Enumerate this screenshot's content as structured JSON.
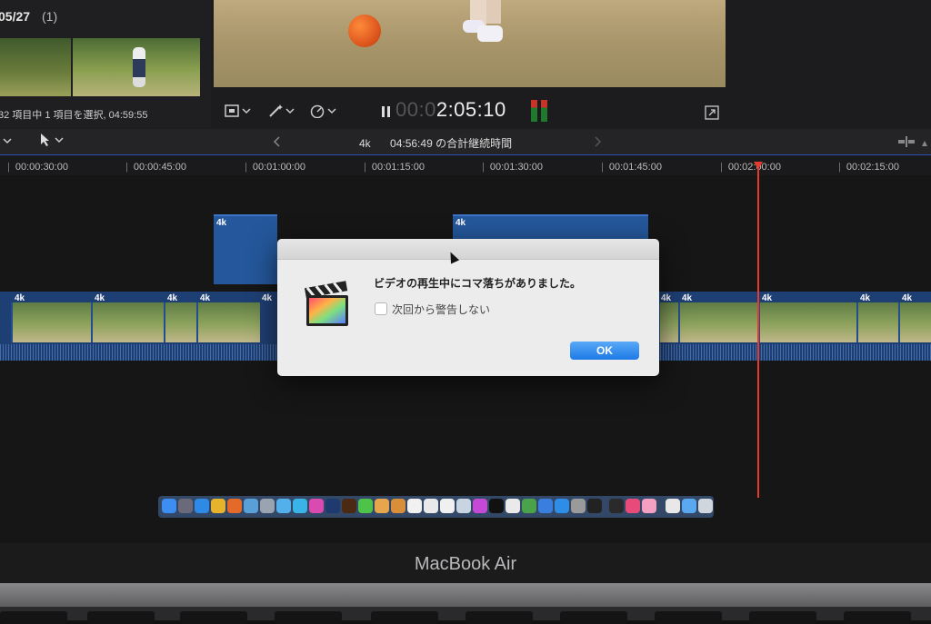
{
  "browser": {
    "date": "05/27",
    "count": "(1)",
    "status": "32 項目中 1 項目を選択, 04:59:55"
  },
  "viewer": {
    "timecode_dim": "00:0",
    "timecode_lit": "2:05:10"
  },
  "timeline": {
    "clip_format": "4k",
    "total_duration": "04:56:49 の合計継続時間",
    "ruler": [
      "00:00:30:00",
      "00:00:45:00",
      "00:01:00:00",
      "00:01:15:00",
      "00:01:30:00",
      "00:01:45:00",
      "00:02:00:00",
      "00:02:15:00"
    ],
    "clip_labels": [
      "4k",
      "4k",
      "4k",
      "4k",
      "4k",
      "4k",
      "4k",
      "4k",
      "4k",
      "4k",
      "4k",
      "4k"
    ]
  },
  "dialog": {
    "message": "ビデオの再生中にコマ落ちがありました。",
    "checkbox_label": "次回から警告しない",
    "ok_label": "OK"
  },
  "laptop": {
    "brand": "MacBook Air"
  },
  "colors": {
    "accent_blue": "#1c7ae6",
    "playhead_red": "#e33b2e",
    "clip_blue": "#24579b"
  },
  "icons": [
    "transform-icon",
    "magic-wand-icon",
    "speed-icon",
    "pause-icon",
    "fullscreen-icon",
    "select-arrow-icon",
    "chevron-left-icon",
    "chevron-right-icon",
    "final-cut-pro-icon"
  ]
}
